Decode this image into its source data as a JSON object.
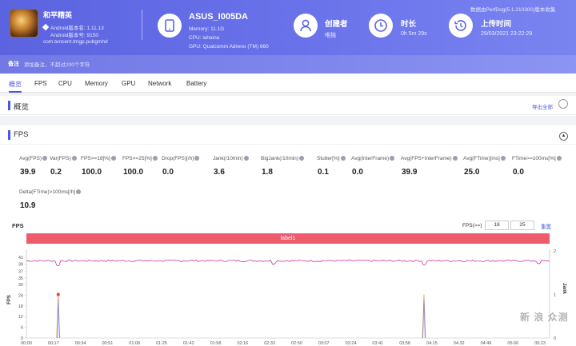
{
  "app": {
    "name": "和平精英",
    "android_version": "Android版本名: 1.11.13",
    "android_code": "Android版本号: 9150",
    "package": "com.tencent.tmgp.pubgmhd"
  },
  "device": {
    "name": "ASUS_I005DA",
    "memory": "Memory: 11.1G",
    "cpu": "CPU: lahaina",
    "gpu": "GPU: Qualcomm Adreno (TM) 660"
  },
  "creator": {
    "title": "创建者",
    "value": "唯独"
  },
  "duration": {
    "title": "时长",
    "value": "0h 5m 29s"
  },
  "upload": {
    "title": "上传时间",
    "value": "29/03/2021 23:22:29"
  },
  "perfdog_version": "数据由PerfDog(5.1.210300)版本收集",
  "note": {
    "label": "备注",
    "placeholder": "添加备注，不超过200个字符"
  },
  "tabs": [
    "概览",
    "FPS",
    "CPU",
    "Memory",
    "GPU",
    "Network",
    "Battery"
  ],
  "overview": {
    "title": "概览",
    "export": "导出全部"
  },
  "fps_section": {
    "title": "FPS"
  },
  "metrics": [
    {
      "label": "Avg(FPS)",
      "value": "39.9"
    },
    {
      "label": "Var(FPS)",
      "value": "0.2"
    },
    {
      "label": "FPS>=18[%]",
      "value": "100.0"
    },
    {
      "label": "FPS>=25[%]",
      "value": "100.0"
    },
    {
      "label": "Drop(FPS)[/h]",
      "value": "0.0"
    },
    {
      "label": "Jank(/10min)",
      "value": "3.6"
    },
    {
      "label": "BigJank(/10min)",
      "value": "1.8"
    },
    {
      "label": "Stutter[%]",
      "value": "0.1"
    },
    {
      "label": "Avg(InterFrame)",
      "value": "0.0"
    },
    {
      "label": "Avg(FPS+InterFrame)",
      "value": "39.9"
    },
    {
      "label": "Avg(FTime)[ms]",
      "value": "25.0"
    },
    {
      "label": "FTime>=100ms[%]",
      "value": "0.0"
    },
    {
      "label": "Delta(FTime)>100ms[/h]",
      "value": "10.9"
    }
  ],
  "chart_controls": {
    "title": "FPS",
    "fps_label": "FPS(>=)",
    "fps_min1": "18",
    "fps_min2": "25",
    "reset": "重置"
  },
  "label_band": "label1",
  "watermark": "新 浪 众测",
  "colors": {
    "accent": "#4a5ae0",
    "fps_line": "#c8379a",
    "jank": "#f29a55",
    "bigjank": "#e04040",
    "band": "#ee5b6c"
  },
  "chart_data": {
    "type": "line",
    "x_tick_labels": [
      "00:00",
      "00:17",
      "00:34",
      "00:51",
      "01:08",
      "01:25",
      "01:42",
      "01:58",
      "02:16",
      "02:33",
      "02:50",
      "03:07",
      "03:24",
      "03:41",
      "03:58",
      "04:15",
      "04:32",
      "04:49",
      "05:06",
      "05:23"
    ],
    "y_left_ticks": [
      "41",
      "39",
      "37",
      "35",
      "30",
      "24",
      "18",
      "12",
      "6",
      "0"
    ],
    "y_left_label": "FPS",
    "y_right_ticks": [
      "2",
      "1",
      "0"
    ],
    "y_right_label": "Jank",
    "fps_ylim": [
      0,
      41
    ],
    "jank_ylim": [
      0,
      2
    ],
    "fps_series": {
      "name": "FPS",
      "baseline": 40,
      "dips": [
        {
          "t": 20,
          "v": 38.6
        },
        {
          "t": 155,
          "v": 39.0
        },
        {
          "t": 250,
          "v": 38.8
        },
        {
          "t": 322,
          "v": 39.2
        }
      ]
    },
    "jank_series": {
      "name": "Jank",
      "events": [
        {
          "t": 20,
          "v": 1
        },
        {
          "t": 250,
          "v": 1
        }
      ]
    },
    "bigjank_series": {
      "name": "BigJank",
      "events": [
        {
          "t": 20,
          "v": 1
        }
      ]
    },
    "x_range_seconds": [
      0,
      329
    ]
  }
}
